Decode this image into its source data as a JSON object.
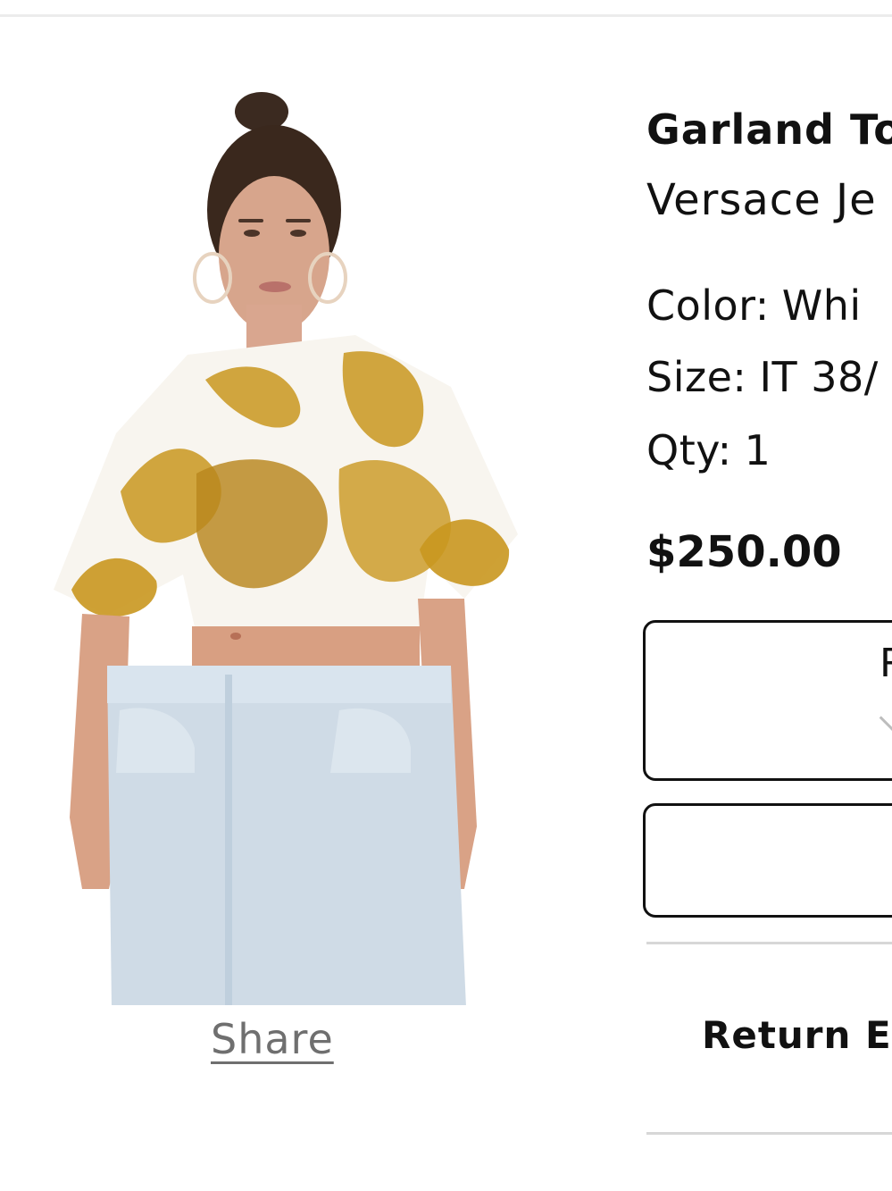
{
  "product": {
    "name": "Garland To",
    "brand": "Versace Je",
    "color_label": "Color:",
    "color_value": "Whi",
    "size_label": "Size:",
    "size_value": "IT 38/",
    "qty_label": "Qty:",
    "qty_value": "1",
    "price": "$250.00",
    "image_alt": "Model wearing white cropped tee with gold baroque print and light wash jeans"
  },
  "actions": {
    "primary_label": "R",
    "primary_icon": "chevron-down-icon",
    "secondary_label": ""
  },
  "share": {
    "label": "Share"
  },
  "returns": {
    "label": "Return E"
  },
  "colors": {
    "text": "#111111",
    "muted": "#6f6f6f",
    "divider": "#d7d7d7",
    "gold": "#c9971f",
    "denim": "#c9d9e8"
  }
}
